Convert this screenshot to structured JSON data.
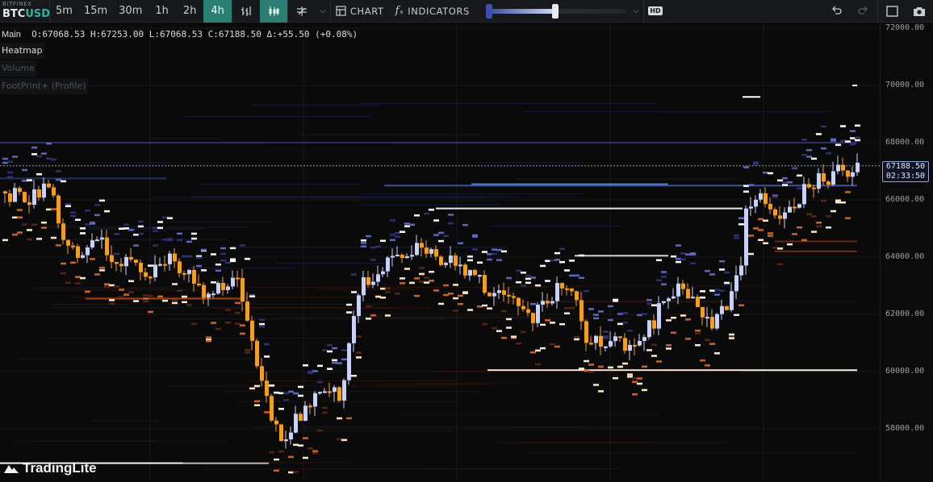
{
  "toolbar": {
    "exchange": "BITFINEX",
    "symbol_base": "BTC",
    "symbol_quote": "USD",
    "timeframes": [
      "5m",
      "15m",
      "30m",
      "1h",
      "2h",
      "4h"
    ],
    "active_timeframe": "4h",
    "chart_label": "CHART",
    "indicators_label": "INDICATORS",
    "fx_glyph": "fₓ",
    "hd_label": "HD",
    "icons": [
      "bars-chart-icon",
      "candles-chart-icon",
      "drawing-tools-icon",
      "chart-type-icon",
      "indicators-icon",
      "undo-icon",
      "redo-icon",
      "fullscreen-icon",
      "camera-icon"
    ]
  },
  "legend": {
    "series": "Main",
    "ohlc_text": "O:67068.53 H:67253.00 L:67068.53 C:67188.50 Δ:+55.50 (+0.08%)",
    "studies": [
      {
        "label": "Heatmap",
        "enabled": true
      },
      {
        "label": "Volume",
        "enabled": false
      },
      {
        "label": "FootPrint+ (Profile)",
        "enabled": false
      }
    ]
  },
  "price_axis": {
    "ticks": [
      "72000.00",
      "70000.00",
      "68000.00",
      "66000.00",
      "64000.00",
      "62000.00",
      "60000.00",
      "58000.00"
    ],
    "last_price": "67188.50",
    "countdown": "02:33:50"
  },
  "brand": "TradingLite",
  "colors": {
    "up": "#c9d2f5",
    "down": "#f0a020",
    "accent": "#2a7f72",
    "quote": "#2fb4a1"
  }
}
